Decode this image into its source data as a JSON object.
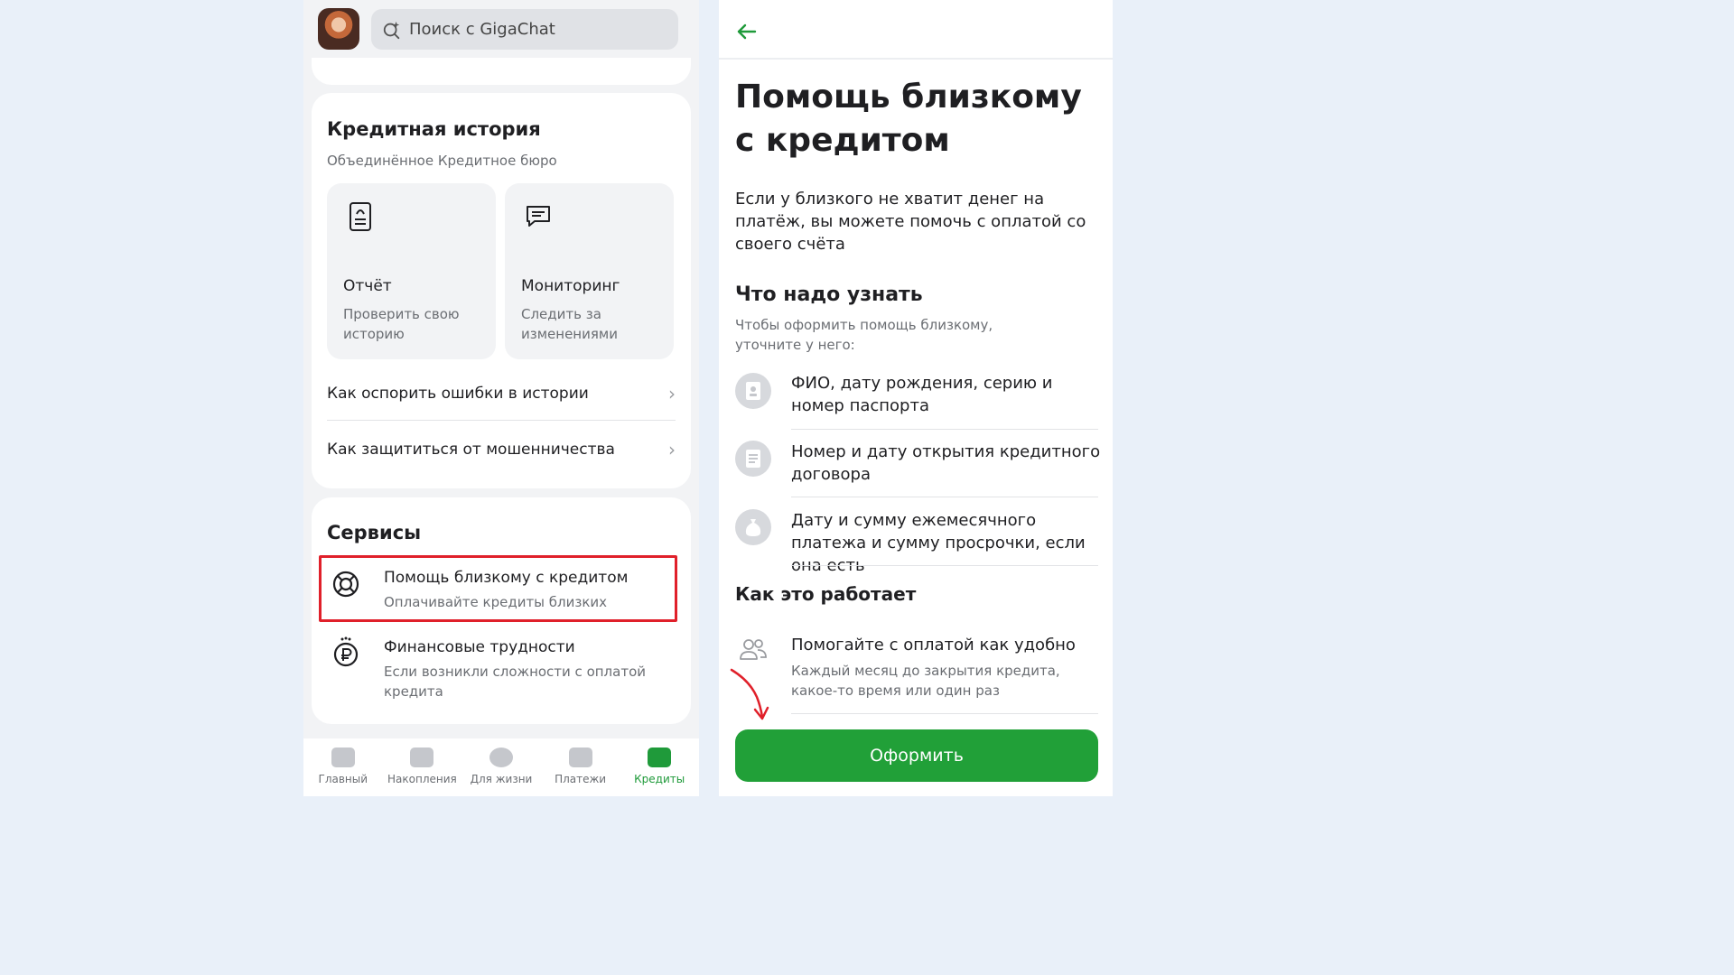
{
  "left": {
    "search": {
      "placeholder": "Поиск с GigaChat"
    },
    "credit_history": {
      "title": "Кредитная история",
      "subtitle": "Объединённое Кредитное бюро",
      "tiles": [
        {
          "name": "Отчёт",
          "desc": "Проверить свою историю",
          "icon": "document-icon"
        },
        {
          "name": "Мониторинг",
          "desc": "Следить за изменениями",
          "icon": "chat-icon"
        }
      ],
      "links": [
        {
          "label": "Как оспорить ошибки в истории"
        },
        {
          "label": "Как защититься от мошенничества"
        }
      ]
    },
    "services": {
      "title": "Сервисы",
      "items": [
        {
          "title": "Помощь близкому с кредитом",
          "desc": "Оплачивайте кредиты близких",
          "icon": "lifebuoy-icon",
          "highlighted": true
        },
        {
          "title": "Финансовые трудности",
          "desc": "Если возникли сложности с оплатой кредита",
          "icon": "ruble-coin-icon"
        }
      ]
    },
    "nav": [
      {
        "label": "Главный",
        "active": false
      },
      {
        "label": "Накопления",
        "active": false
      },
      {
        "label": "Для жизни",
        "active": false
      },
      {
        "label": "Платежи",
        "active": false
      },
      {
        "label": "Кредиты",
        "active": true
      }
    ]
  },
  "right": {
    "title": "Помощь близкому с кредитом",
    "intro": "Если у близкого не хватит денег на платёж, вы можете помочь с оплатой со своего счёта",
    "what_to_know": {
      "title": "Что надо узнать",
      "subtitle": "Чтобы оформить помощь близкому, уточните у него:",
      "items": [
        {
          "text": "ФИО, дату рождения, серию и номер паспорта",
          "icon": "passport-icon"
        },
        {
          "text": "Номер и дату открытия кредитного договора",
          "icon": "contract-icon"
        },
        {
          "text": "Дату и сумму ежемесячного платежа и сумму просрочки, если она есть",
          "icon": "money-bag-icon"
        }
      ]
    },
    "how_it_works": {
      "title": "Как это работает",
      "item_title": "Помогайте с оплатой как удобно",
      "item_desc": "Каждый месяц до закрытия кредита, какое-то время или один раз",
      "icon": "people-icon"
    },
    "cta_label": "Оформить"
  },
  "colors": {
    "brand_green": "#21a038",
    "highlight_red": "#e0202a",
    "bg": "#e9f0f9"
  }
}
